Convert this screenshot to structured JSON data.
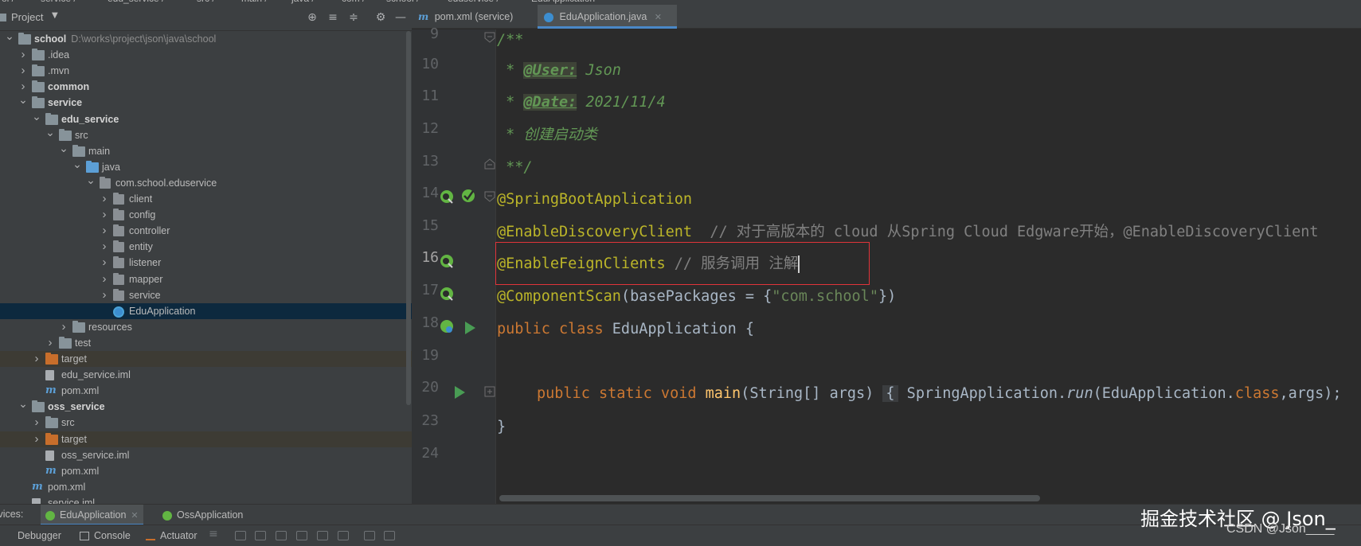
{
  "breadcrumb": [
    "ol",
    "service",
    "edu_service",
    "src",
    "main",
    "java",
    "com",
    "school",
    "eduservice",
    "EduApplication"
  ],
  "project_panel": {
    "title": "Project",
    "tree": [
      {
        "level": 0,
        "arrow": "down",
        "icon": "module-folder-icon",
        "label": "school",
        "bold": true,
        "path": "D:\\works\\project\\json\\java\\school"
      },
      {
        "level": 1,
        "arrow": "right",
        "icon": "folder-icon",
        "label": ".idea"
      },
      {
        "level": 1,
        "arrow": "right",
        "icon": "folder-icon",
        "label": ".mvn"
      },
      {
        "level": 1,
        "arrow": "right",
        "icon": "module-folder-icon",
        "label": "common",
        "bold": true
      },
      {
        "level": 1,
        "arrow": "down",
        "icon": "module-folder-icon",
        "label": "service",
        "bold": true
      },
      {
        "level": 2,
        "arrow": "down",
        "icon": "module-folder-icon",
        "label": "edu_service",
        "bold": true
      },
      {
        "level": 3,
        "arrow": "down",
        "icon": "folder-icon",
        "label": "src"
      },
      {
        "level": 4,
        "arrow": "down",
        "icon": "folder-icon",
        "label": "main"
      },
      {
        "level": 5,
        "arrow": "down",
        "icon": "source-folder-icon",
        "label": "java"
      },
      {
        "level": 6,
        "arrow": "down",
        "icon": "package-icon",
        "label": "com.school.eduservice"
      },
      {
        "level": 7,
        "arrow": "right",
        "icon": "package-icon",
        "label": "client"
      },
      {
        "level": 7,
        "arrow": "right",
        "icon": "package-icon",
        "label": "config"
      },
      {
        "level": 7,
        "arrow": "right",
        "icon": "package-icon",
        "label": "controller"
      },
      {
        "level": 7,
        "arrow": "right",
        "icon": "package-icon",
        "label": "entity"
      },
      {
        "level": 7,
        "arrow": "right",
        "icon": "package-icon",
        "label": "listener"
      },
      {
        "level": 7,
        "arrow": "right",
        "icon": "package-icon",
        "label": "mapper"
      },
      {
        "level": 7,
        "arrow": "right",
        "icon": "package-icon",
        "label": "service"
      },
      {
        "level": 7,
        "arrow": "none",
        "icon": "spring-class-icon",
        "label": "EduApplication",
        "selected": true
      },
      {
        "level": 4,
        "arrow": "right",
        "icon": "resources-folder-icon",
        "label": "resources"
      },
      {
        "level": 3,
        "arrow": "right",
        "icon": "folder-icon",
        "label": "test"
      },
      {
        "level": 2,
        "arrow": "right",
        "icon": "excluded-folder-icon",
        "label": "target",
        "excluded": true
      },
      {
        "level": 2,
        "arrow": "none",
        "icon": "iml-file-icon",
        "label": "edu_service.iml"
      },
      {
        "level": 2,
        "arrow": "none",
        "icon": "maven-icon",
        "label": "pom.xml"
      },
      {
        "level": 1,
        "arrow": "down",
        "icon": "module-folder-icon",
        "label": "oss_service",
        "bold": true
      },
      {
        "level": 2,
        "arrow": "right",
        "icon": "folder-icon",
        "label": "src"
      },
      {
        "level": 2,
        "arrow": "right",
        "icon": "excluded-folder-icon",
        "label": "target",
        "excluded": true
      },
      {
        "level": 2,
        "arrow": "none",
        "icon": "iml-file-icon",
        "label": "oss_service.iml"
      },
      {
        "level": 2,
        "arrow": "none",
        "icon": "maven-icon",
        "label": "pom.xml"
      },
      {
        "level": 1,
        "arrow": "none",
        "icon": "maven-icon",
        "label": "pom.xml"
      },
      {
        "level": 1,
        "arrow": "none",
        "icon": "iml-file-icon",
        "label": "service.iml"
      }
    ]
  },
  "editor": {
    "tabs": [
      {
        "label": "pom.xml (service)",
        "icon": "maven-icon",
        "active": false
      },
      {
        "label": "EduApplication.java",
        "icon": "spring-class-icon",
        "active": true
      }
    ],
    "lines": [
      {
        "num": "9"
      },
      {
        "num": "10"
      },
      {
        "num": "11"
      },
      {
        "num": "12"
      },
      {
        "num": "13"
      },
      {
        "num": "14"
      },
      {
        "num": "15"
      },
      {
        "num": "16",
        "current": true
      },
      {
        "num": "17"
      },
      {
        "num": "18"
      },
      {
        "num": "19"
      },
      {
        "num": "20"
      },
      {
        "num": "23"
      },
      {
        "num": "24"
      }
    ],
    "code": {
      "l9": "/**",
      "l10_star": " * ",
      "l10_tag": "@User:",
      "l10_val": " Json",
      "l11_star": " * ",
      "l11_tag": "@Date:",
      "l11_val": " 2021/11/4",
      "l12": " * 创建启动类",
      "l13": " **/",
      "l14": "@SpringBootApplication",
      "l15_ann": "@EnableDiscoveryClient",
      "l15_cmt": "  // 对于高版本的 cloud 从Spring Cloud Edgware开始，@EnableDiscoveryClient",
      "l16_ann": "@EnableFeignClients",
      "l16_cmt": " // 服务调用 注解",
      "l17_ann": "@ComponentScan",
      "l17_a": "(basePackages = {",
      "l17_str": "\"com.school\"",
      "l17_b": "})",
      "l18_kw": "public class ",
      "l18_name": "EduApplication {",
      "l20_kw": "public static void ",
      "l20_fn": "main",
      "l20_a": "(String[] args) ",
      "l20_fold": "{",
      "l20_b": " SpringApplication.",
      "l20_run": "run",
      "l20_c": "(EduApplication.",
      "l20_cls": "class",
      "l20_d": ",args);",
      "l23": "}"
    }
  },
  "services": {
    "label": "Services:",
    "tabs": [
      {
        "label": "EduApplication",
        "active": true
      },
      {
        "label": "OssApplication",
        "active": false
      }
    ]
  },
  "debug_toolbar": {
    "debugger": "Debugger",
    "console": "Console",
    "actuator": "Actuator"
  },
  "watermark": {
    "main": "掘金技术社区 @ Json_",
    "sub": "CSDN @Json____"
  },
  "colors": {
    "annotation": "#bbb529",
    "keyword": "#cc7832",
    "doc_comment": "#629755",
    "highlight_box": "#e0343a"
  }
}
